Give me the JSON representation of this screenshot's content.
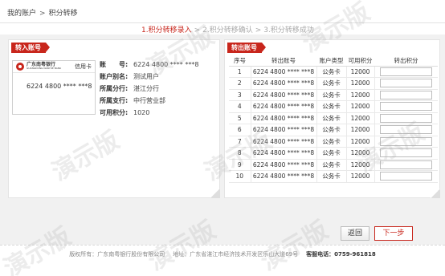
{
  "breadcrumb": {
    "home": "我的账户",
    "sep": ">",
    "current": "积分转移"
  },
  "steps": {
    "step1": "1.积分转移录入",
    "step2": "2.积分转移确认",
    "step3": "3.积分转移成功",
    "arrow": ">"
  },
  "left_panel": {
    "tab": "转入账号",
    "card": {
      "bank_name_cn": "广东南粤银行",
      "bank_name_en": "GUANGDONG NANYUE BANK",
      "card_type": "信用卡",
      "card_number": "6224 4800 **** ***8"
    },
    "info": [
      {
        "label": "账　　号:",
        "value": "6224 4800 **** ***8"
      },
      {
        "label": "账户别名:",
        "value": "测试用户"
      },
      {
        "label": "所属分行:",
        "value": "湛江分行"
      },
      {
        "label": "所属支行:",
        "value": "中行营业部"
      },
      {
        "label": "可用积分:",
        "value": "1020"
      }
    ]
  },
  "right_panel": {
    "tab": "转出账号",
    "headers": [
      "序号",
      "转出账号",
      "账户类型",
      "可用积分",
      "转出积分"
    ],
    "rows": [
      {
        "no": "1",
        "account": "6224 4800 **** ***8",
        "type": "公务卡",
        "points": "12000",
        "transfer": ""
      },
      {
        "no": "2",
        "account": "6224 4800 **** ***8",
        "type": "公务卡",
        "points": "12000",
        "transfer": ""
      },
      {
        "no": "3",
        "account": "6224 4800 **** ***8",
        "type": "公务卡",
        "points": "12000",
        "transfer": ""
      },
      {
        "no": "4",
        "account": "6224 4800 **** ***8",
        "type": "公务卡",
        "points": "12000",
        "transfer": ""
      },
      {
        "no": "5",
        "account": "6224 4800 **** ***8",
        "type": "公务卡",
        "points": "12000",
        "transfer": ""
      },
      {
        "no": "6",
        "account": "6224 4800 **** ***8",
        "type": "公务卡",
        "points": "12000",
        "transfer": ""
      },
      {
        "no": "7",
        "account": "6224 4800 **** ***8",
        "type": "公务卡",
        "points": "12000",
        "transfer": ""
      },
      {
        "no": "8",
        "account": "6224 4800 **** ***8",
        "type": "公务卡",
        "points": "12000",
        "transfer": ""
      },
      {
        "no": "9",
        "account": "6224 4800 **** ***8",
        "type": "公务卡",
        "points": "12000",
        "transfer": ""
      },
      {
        "no": "10",
        "account": "6224 4800 **** ***8",
        "type": "公务卡",
        "points": "12000",
        "transfer": ""
      }
    ]
  },
  "buttons": {
    "back": "返回",
    "next": "下一步"
  },
  "footer": {
    "copyright": "版权所有：广东南粤银行股份有限公司",
    "address": "地址：广东省湛江市经济技术开发区乐山大道69号",
    "tel_label": "客服电话：",
    "tel": "0759-961818"
  },
  "watermark": "演示版",
  "colors": {
    "accent": "#c8261c",
    "muted_step": "#a8a8a8"
  }
}
